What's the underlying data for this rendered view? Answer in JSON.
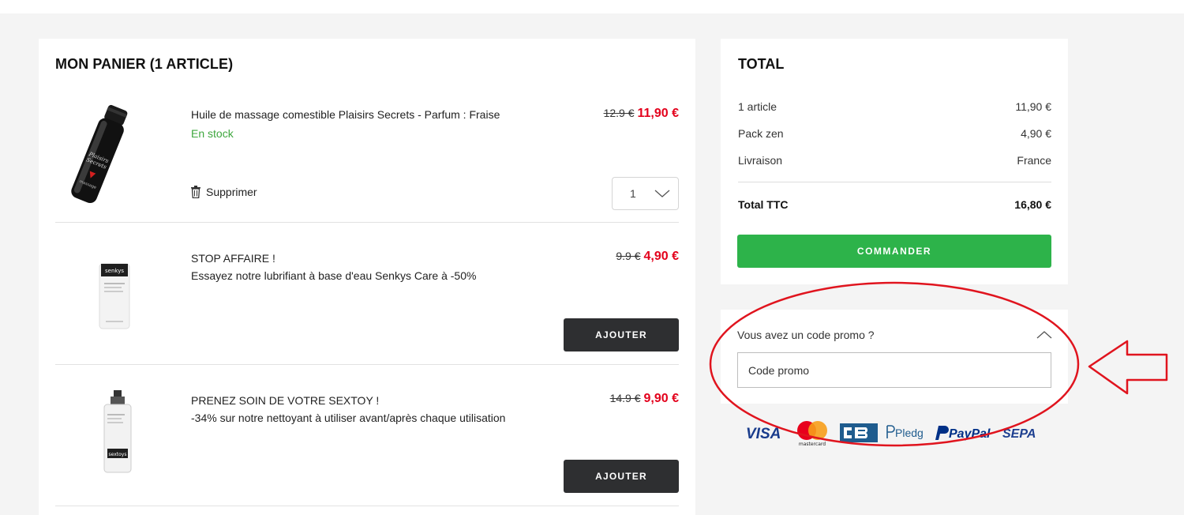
{
  "cart": {
    "title": "MON PANIER (1 ARTICLE)",
    "items": [
      {
        "name": "Huile de massage comestible Plaisirs Secrets - Parfum : Fraise",
        "stock": "En stock",
        "old_price": "12.9 €",
        "new_price": "11,90 €",
        "remove_label": "Supprimer",
        "quantity": "1"
      }
    ],
    "upsells": [
      {
        "line1": "STOP AFFAIRE !",
        "line2": "Essayez notre lubrifiant à base d'eau Senkys Care à -50%",
        "old_price": "9.9 €",
        "new_price": "4,90 €",
        "button_label": "AJOUTER"
      },
      {
        "line1": "PRENEZ SOIN DE VOTRE SEXTOY !",
        "line2": "-34% sur notre nettoyant à utiliser avant/après chaque utilisation",
        "old_price": "14.9 €",
        "new_price": "9,90 €",
        "button_label": "AJOUTER"
      }
    ]
  },
  "total": {
    "title": "TOTAL",
    "rows": [
      {
        "label": "1 article",
        "value": "11,90 €"
      },
      {
        "label": "Pack zen",
        "value": "4,90 €"
      },
      {
        "label": "Livraison",
        "value": "France"
      }
    ],
    "total_label": "Total TTC",
    "total_value": "16,80 €",
    "order_button": "COMMANDER"
  },
  "promo": {
    "toggle_label": "Vous avez un code promo ?",
    "placeholder": "Code promo"
  },
  "payments": {
    "visa": "VISA",
    "mastercard": "mastercard",
    "pledg": "Pledg",
    "paypal": "PayPal",
    "sepa": "SEPA"
  },
  "colors": {
    "price_red": "#e3001b",
    "stock_green": "#3ea73e",
    "order_green": "#2db34a",
    "dark_button": "#2e2f31",
    "annotation_red": "#e0141e"
  }
}
